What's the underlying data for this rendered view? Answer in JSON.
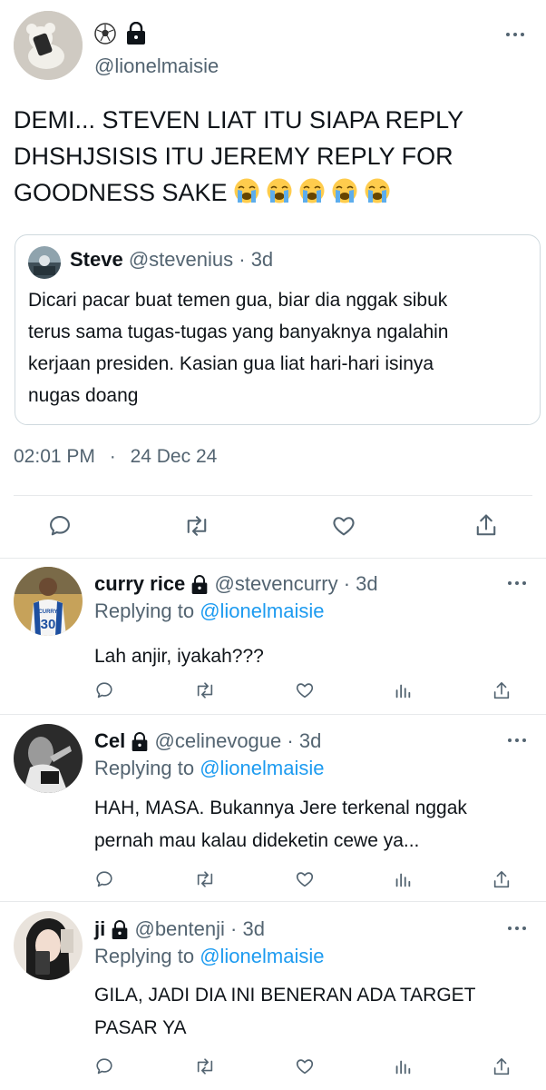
{
  "main_tweet": {
    "handle": "@lionelmaisie",
    "text_lines": [
      "DEMI... STEVEN LIAT ITU SIAPA REPLY",
      "DHSHJSISIS ITU JEREMY REPLY FOR",
      "GOODNESS SAKE"
    ],
    "time": "02:01 PM",
    "separator": "·",
    "date": "24 Dec 24",
    "badge_icons": [
      "soccer-ball-icon",
      "lock-icon"
    ],
    "emoji": [
      "loudly-crying-face",
      "loudly-crying-face",
      "loudly-crying-face",
      "loudly-crying-face",
      "loudly-crying-face"
    ]
  },
  "quoted_tweet": {
    "name": "Steve",
    "handle": "@stevenius",
    "meta": "· 3d",
    "text_lines": [
      "Dicari pacar buat temen gua, biar dia nggak sibuk",
      "terus sama tugas-tugas yang banyaknya ngalahin",
      "kerjaan presiden. Kasian gua liat hari-hari isinya",
      "nugas doang"
    ]
  },
  "main_actions": [
    "reply-icon",
    "retweet-icon",
    "like-icon",
    "share-icon"
  ],
  "replies": [
    {
      "name": "curry rice",
      "handle": "@stevencurry",
      "time": "· 3d",
      "replying_prefix": "Replying to",
      "replying_to": "@lionelmaisie",
      "text_lines": [
        "Lah anjir, iyakah???"
      ]
    },
    {
      "name": "Cel",
      "handle": "@celinevogue",
      "time": "· 3d",
      "replying_prefix": "Replying to",
      "replying_to": "@lionelmaisie",
      "text_lines": [
        "HAH, MASA. Bukannya Jere terkenal nggak",
        "pernah mau kalau dideketin cewe ya..."
      ]
    },
    {
      "name": "ji",
      "handle": "@bentenji",
      "time": "· 3d",
      "replying_prefix": "Replying to",
      "replying_to": "@lionelmaisie",
      "text_lines": [
        "GILA, JADI DIA INI BENERAN ADA TARGET",
        "PASAR YA"
      ]
    }
  ],
  "reply_actions": [
    "reply-icon",
    "retweet-icon",
    "like-icon",
    "views-icon",
    "share-icon"
  ],
  "jersey_number": "30",
  "colors": {
    "text": "#0f1419",
    "muted": "#536471",
    "link": "#1d9bf0",
    "divider": "#e7e9eb"
  }
}
